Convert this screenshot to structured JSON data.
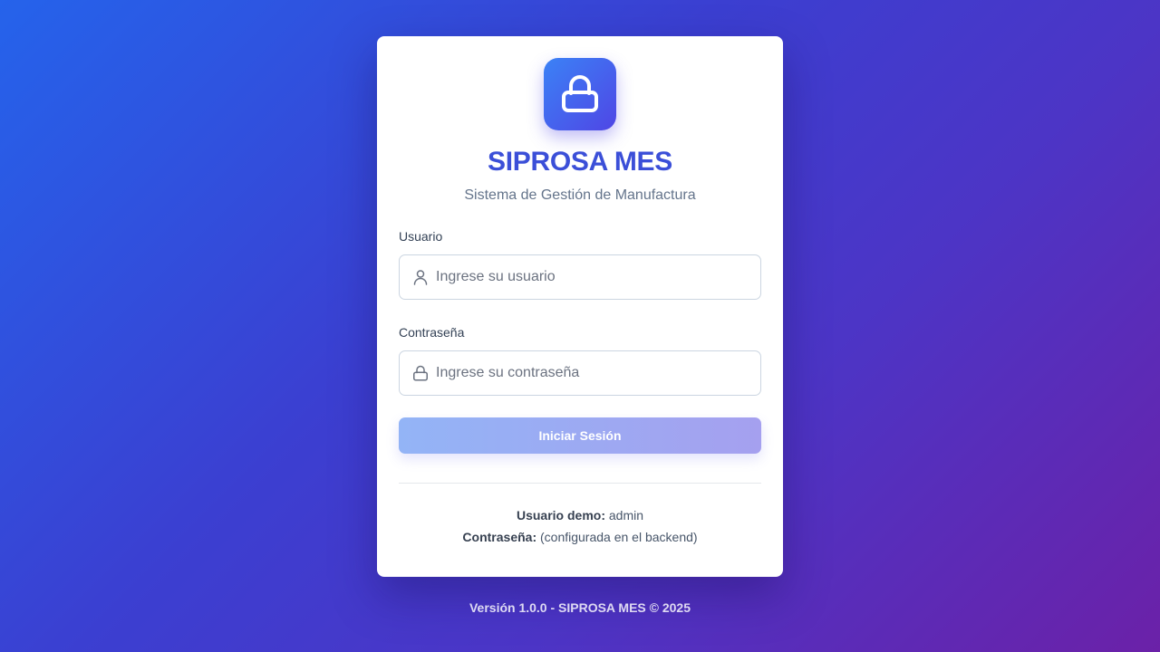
{
  "app": {
    "title": "SIPROSA MES",
    "subtitle": "Sistema de Gestión de Manufactura",
    "logo_icon": "lock-icon"
  },
  "form": {
    "username": {
      "label": "Usuario",
      "placeholder": "Ingrese su usuario",
      "value": "",
      "icon": "user-icon"
    },
    "password": {
      "label": "Contraseña",
      "placeholder": "Ingrese su contraseña",
      "value": "",
      "icon": "lock-icon"
    },
    "submit_label": "Iniciar Sesión"
  },
  "demo": {
    "user_label": "Usuario demo:",
    "user_value": "admin",
    "password_label": "Contraseña:",
    "password_value": "(configurada en el backend)"
  },
  "footer": {
    "text": "Versión 1.0.0 - SIPROSA MES © 2025"
  },
  "colors": {
    "accent": "#3b4fd8",
    "gradient_start": "#2563eb",
    "gradient_end": "#6b21a8"
  }
}
